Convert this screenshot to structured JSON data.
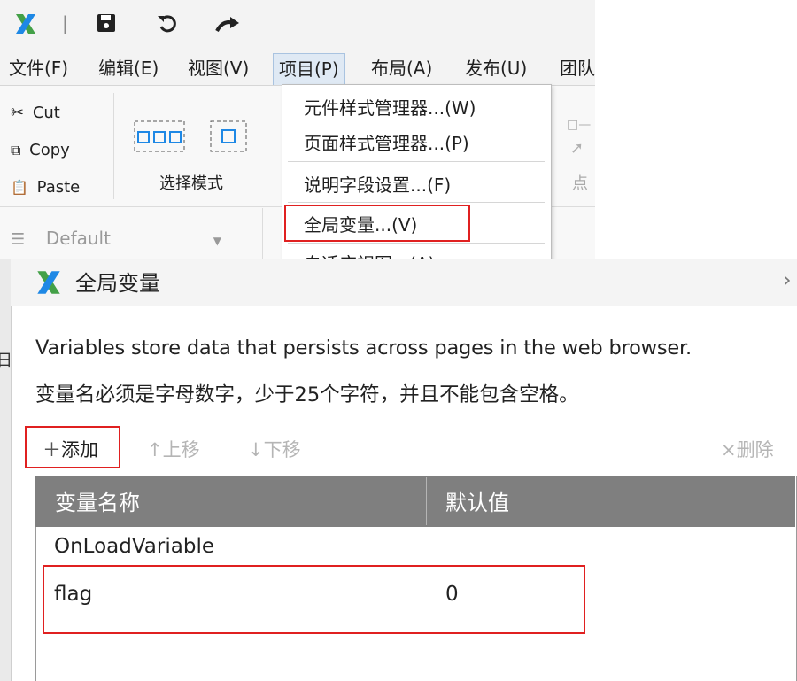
{
  "quick_access": {
    "logo_glyph": "X",
    "separator": "|"
  },
  "menubar": {
    "items": [
      "文件(F)",
      "编辑(E)",
      "视图(V)",
      "项目(P)",
      "布局(A)",
      "发布(U)",
      "团队"
    ]
  },
  "ribbon": {
    "cut_label": "Cut",
    "copy_label": "Copy",
    "paste_label": "Paste",
    "select_mode_label": "选择模式",
    "default_style": "Default",
    "partial_label": "点"
  },
  "dropdown": {
    "items": [
      "元件样式管理器...(W)",
      "页面样式管理器...(P)",
      "说明字段设置...(F)",
      "全局变量...(V)",
      "自适应视图...(A)"
    ]
  },
  "dialog": {
    "title": "全局变量",
    "description_en": "Variables store data that persists across pages in the web browser.",
    "description_zh": "变量名必须是字母数字，少于25个字符，并且不能包含空格。",
    "toolbar": {
      "add": "添加",
      "move_up": "上移",
      "move_down": "下移",
      "delete": "删除"
    },
    "table": {
      "headers": [
        "变量名称",
        "默认值"
      ],
      "rows": [
        {
          "name": "OnLoadVariable",
          "default": ""
        },
        {
          "name": "flag",
          "default": "0"
        }
      ]
    },
    "left_edge_text": "日"
  },
  "colors": {
    "logo_blue": "#1e88e5",
    "logo_green": "#43a047",
    "highlight_red": "#e02020",
    "table_header": "#7f7f7f"
  }
}
